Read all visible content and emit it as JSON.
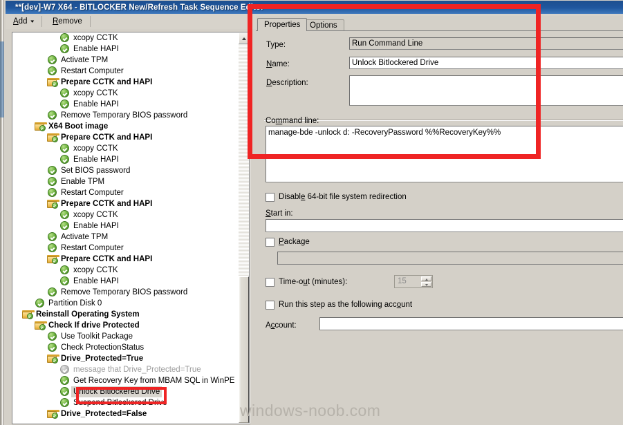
{
  "window": {
    "title": "**[dev]-W7 X64 - BITLOCKER New/Refresh Task Sequence Editor"
  },
  "toolbar": {
    "add_label": "Add",
    "add_caret": "▾",
    "remove_label": "Remove",
    "icons": [
      "collapse-all-icon",
      "expand-all-icon"
    ]
  },
  "tree": {
    "items": [
      {
        "label": "xcopy CCTK",
        "indent": 5,
        "type": "step"
      },
      {
        "label": "Enable HAPI",
        "indent": 5,
        "type": "step"
      },
      {
        "label": "Activate TPM",
        "indent": 4,
        "type": "step"
      },
      {
        "label": "Restart Computer",
        "indent": 4,
        "type": "step"
      },
      {
        "label": "Prepare CCTK and HAPI",
        "indent": 4,
        "type": "folder"
      },
      {
        "label": "xcopy CCTK",
        "indent": 5,
        "type": "step"
      },
      {
        "label": "Enable HAPI",
        "indent": 5,
        "type": "step"
      },
      {
        "label": "Remove Temporary BIOS password",
        "indent": 4,
        "type": "step"
      },
      {
        "label": "X64 Boot image",
        "indent": 3,
        "type": "folder"
      },
      {
        "label": "Prepare CCTK and HAPI",
        "indent": 4,
        "type": "folder"
      },
      {
        "label": "xcopy CCTK",
        "indent": 5,
        "type": "step"
      },
      {
        "label": "Enable HAPI",
        "indent": 5,
        "type": "step"
      },
      {
        "label": "Set BIOS password",
        "indent": 4,
        "type": "step"
      },
      {
        "label": "Enable TPM",
        "indent": 4,
        "type": "step"
      },
      {
        "label": "Restart Computer",
        "indent": 4,
        "type": "step"
      },
      {
        "label": "Prepare CCTK and HAPI",
        "indent": 4,
        "type": "folder"
      },
      {
        "label": "xcopy CCTK",
        "indent": 5,
        "type": "step"
      },
      {
        "label": "Enable HAPI",
        "indent": 5,
        "type": "step"
      },
      {
        "label": "Activate TPM",
        "indent": 4,
        "type": "step"
      },
      {
        "label": "Restart Computer",
        "indent": 4,
        "type": "step"
      },
      {
        "label": "Prepare CCTK and HAPI",
        "indent": 4,
        "type": "folder"
      },
      {
        "label": "xcopy CCTK",
        "indent": 5,
        "type": "step"
      },
      {
        "label": "Enable HAPI",
        "indent": 5,
        "type": "step"
      },
      {
        "label": "Remove Temporary BIOS password",
        "indent": 4,
        "type": "step"
      },
      {
        "label": "Partition Disk 0",
        "indent": 3,
        "type": "step"
      },
      {
        "label": "Reinstall Operating System",
        "indent": 2,
        "type": "folder"
      },
      {
        "label": "Check If drive Protected",
        "indent": 3,
        "type": "folder"
      },
      {
        "label": "Use Toolkit Package",
        "indent": 4,
        "type": "step"
      },
      {
        "label": "Check ProtectionStatus",
        "indent": 4,
        "type": "step"
      },
      {
        "label": "Drive_Protected=True",
        "indent": 4,
        "type": "folder"
      },
      {
        "label": "message that Drive_Protected=True",
        "indent": 5,
        "type": "step-disabled"
      },
      {
        "label": "Get Recovery Key from MBAM SQL in WinPE",
        "indent": 5,
        "type": "step"
      },
      {
        "label": "Unlock Bitlockered Drive",
        "indent": 5,
        "type": "step-selected"
      },
      {
        "label": "Suspend Bitlockered Drive",
        "indent": 5,
        "type": "step"
      },
      {
        "label": "Drive_Protected=False",
        "indent": 4,
        "type": "folder"
      }
    ]
  },
  "properties": {
    "tabs": [
      {
        "label": "Properties",
        "active": true
      },
      {
        "label": "Options",
        "active": false
      }
    ],
    "type_label": "Type:",
    "type_value": "Run Command Line",
    "name_label": "Name:",
    "name_label_mnemonic": "N",
    "name_value": "Unlock Bitlockered Drive",
    "description_label": "Description:",
    "description_label_mnemonic": "D",
    "description_value": "",
    "command_line_label": "Command line:",
    "command_line_value": "manage-bde -unlock d: -RecoveryPassword %%RecoveryKey%%",
    "disable_redirection_label": "Disable 64-bit file system redirection",
    "disable_redirection_checked": false,
    "start_in_label": "Start in:",
    "start_in_value": "",
    "package_label": "Package",
    "package_checked": false,
    "package_value": "",
    "timeout_label": "Time-out (minutes):",
    "timeout_checked": false,
    "timeout_value": "15",
    "run_as_label": "Run this step as the following account",
    "run_as_checked": false,
    "account_label": "Account:",
    "account_value": ""
  },
  "watermark": {
    "text": "windows-noob.com"
  },
  "colors": {
    "titlebar": "#1e549a",
    "annotation": "#ef2424",
    "dialog_face": "#d4d0c8",
    "check_green": "#6db33f",
    "folder_yellow": "#f2c45e"
  }
}
